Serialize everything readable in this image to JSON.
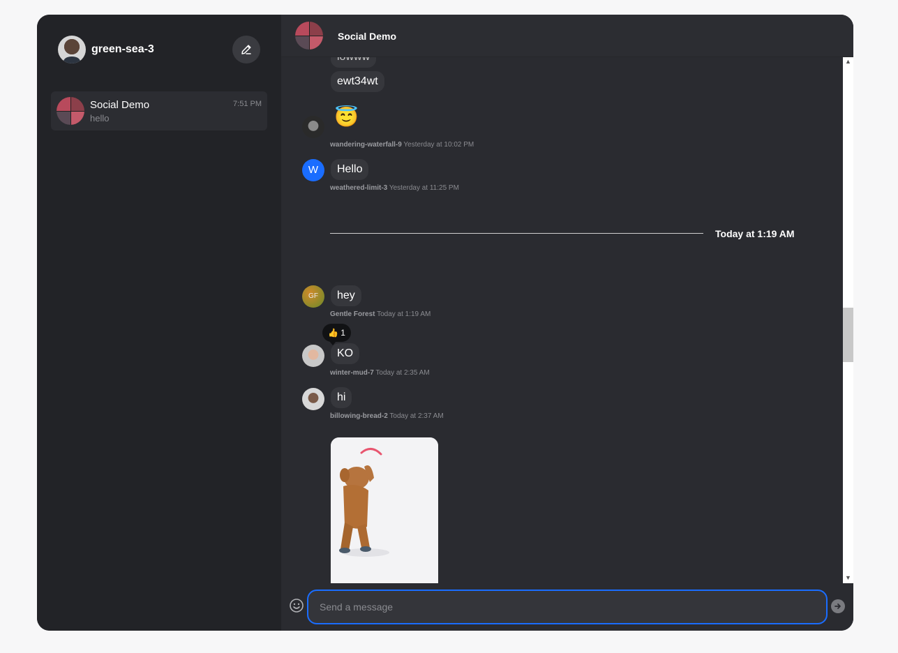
{
  "user": {
    "name": "green-sea-3"
  },
  "sidebar": {
    "channels": [
      {
        "name": "Social Demo",
        "preview": "hello",
        "time": "7:51 PM"
      }
    ]
  },
  "header": {
    "title": "Social Demo"
  },
  "messages": {
    "partial_top": "lowww",
    "ewt": "ewt34wt",
    "emoji_message": "😇",
    "m1": {
      "author": "wandering-waterfall-9",
      "time": "Yesterday at 10:02 PM"
    },
    "m2": {
      "avatar_initial": "W",
      "text": "Hello",
      "author": "weathered-limit-3",
      "time": "Yesterday at 11:25 PM"
    },
    "divider": "Today at 1:19 AM",
    "m3": {
      "avatar_initials": "GF",
      "text": "hey",
      "author": "Gentle Forest",
      "time": "Today at 1:19 AM"
    },
    "m4": {
      "reaction_emoji": "👍",
      "reaction_count": "1",
      "text": "KO",
      "author": "winter-mud-7",
      "time": "Today at 2:35 AM"
    },
    "m5": {
      "text": "hi",
      "author": "billowing-bread-2",
      "time": "Today at 2:37 AM"
    }
  },
  "composer": {
    "placeholder": "Send a message"
  },
  "colors": {
    "accent": "#1a6dff",
    "sidebar_bg": "#222327",
    "main_bg": "#2a2b30",
    "bubble_bg": "#36373c"
  },
  "icons": [
    "compose-icon",
    "emoji-icon",
    "send-icon",
    "scroll-up-icon",
    "scroll-down-icon"
  ]
}
